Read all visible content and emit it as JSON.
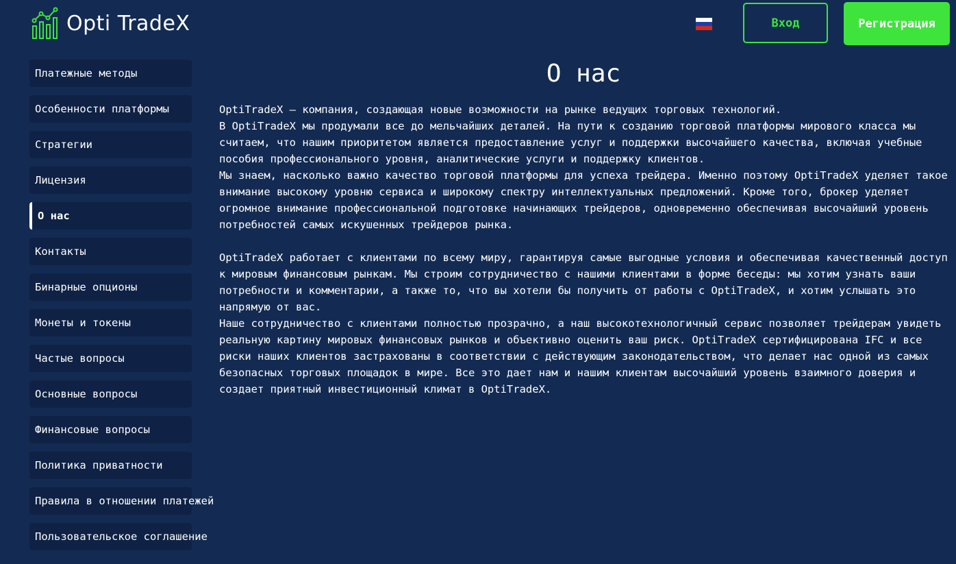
{
  "brand": {
    "name": "Opti TradeX",
    "accent_color": "#3ee43b",
    "background_color": "#132b52",
    "logo_icon": "bar-chart-logo-icon"
  },
  "header": {
    "language_flag": "russian-flag-icon",
    "login_label": "Вход",
    "register_label": "Регистрация"
  },
  "sidebar": {
    "items": [
      {
        "label": "Платежные методы",
        "active": false
      },
      {
        "label": "Особенности платформы",
        "active": false
      },
      {
        "label": "Стратегии",
        "active": false
      },
      {
        "label": "Лицензия",
        "active": false
      },
      {
        "label": "О нас",
        "active": true
      },
      {
        "label": "Контакты",
        "active": false
      },
      {
        "label": "Бинарные опционы",
        "active": false
      },
      {
        "label": "Монеты и токены",
        "active": false
      },
      {
        "label": "Частые вопросы",
        "active": false
      },
      {
        "label": "Основные вопросы",
        "active": false
      },
      {
        "label": "Финансовые вопросы",
        "active": false
      },
      {
        "label": "Политика приватности",
        "active": false
      },
      {
        "label": "Правила в отношении платежей",
        "active": false
      },
      {
        "label": "Пользовательское соглашение",
        "active": false
      }
    ]
  },
  "main": {
    "title": "О нас",
    "paragraphs": [
      "OptiTradeX —  компания, создающая новые возможности на рынке ведущих торговых технологий.",
      "В OptiTradeX мы продумали все до мельчайших деталей. На пути к созданию торговой платформы мирового класса мы считаем, что нашим приоритетом является предоставление услуг и поддержки высочайшего качества, включая учебные пособия профессионального уровня, аналитические услуги и поддержку клиентов.",
      "Мы знаем, насколько важно качество торговой платформы для успеха трейдера. Именно поэтому OptiTradeX уделяет такое внимание высокому уровню сервиса и широкому спектру интеллектуальных предложений. Кроме того, брокер уделяет огромное внимание профессиональной подготовке начинающих трейдеров, одновременно обеспечивая высочайший уровень потребностей самых искушенных трейдеров рынка.",
      "OptiTradeX работает с клиентами по всему миру, гарантируя самые выгодные условия и обеспечивая качественный доступ к мировым финансовым рынкам. Мы строим сотрудничество с нашими клиентами в форме беседы: мы хотим узнать ваши потребности и комментарии, а также то, что вы хотели бы получить от работы с OptiTradeX, и хотим услышать это напрямую от вас.",
      "Наше сотрудничество с клиентами полностью прозрачно, а наш высокотехнологичный сервис позволяет трейдерам увидеть реальную картину мировых финансовых рынков и объективно оценить ваш риск. OptiTradeX сертифицирована IFC и все риски наших клиентов застрахованы в соответствии с действующим законодательством, что делает нас одной из самых безопасных торговых площадок в мире. Все это дает нам и нашим клиентам высочайший уровень взаимного доверия и создает приятный инвестиционный климат в OptiTradeX."
    ]
  }
}
